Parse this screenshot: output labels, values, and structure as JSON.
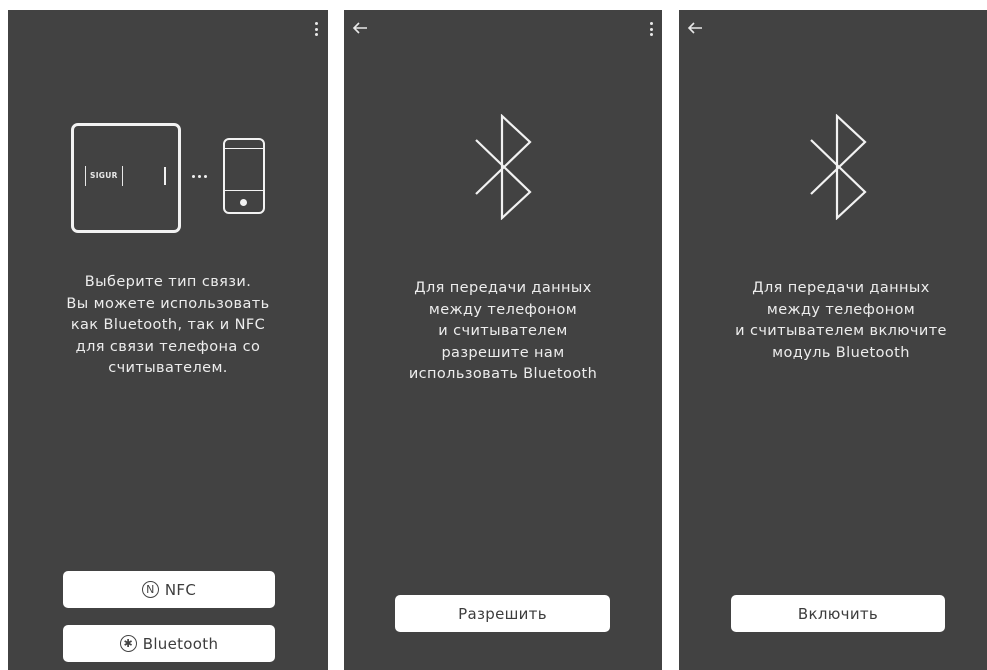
{
  "screens": [
    {
      "id": "connection-type",
      "illustration": {
        "reader_logo": "SIGUR"
      },
      "message": "Выберите тип связи.\nВы можете использовать\nкак Bluetooth, так и NFC\nдля связи телефона со\nсчитывателем.",
      "buttons": [
        {
          "label": "NFC",
          "icon": "nfc-icon",
          "icon_glyph": "N"
        },
        {
          "label": "Bluetooth",
          "icon": "bluetooth-icon",
          "icon_glyph": "✱"
        }
      ]
    },
    {
      "id": "bluetooth-permission",
      "message": "Для передачи данных\nмежду телефоном\nи считывателем\nразрешите нам\nиспользовать Bluetooth",
      "button_label": "Разрешить"
    },
    {
      "id": "bluetooth-enable",
      "message": "Для передачи данных\nмежду телефоном\nи считывателем включите\nмодуль Bluetooth",
      "button_label": "Включить"
    }
  ],
  "colors": {
    "screen_bg": "#424242",
    "text": "#ededed",
    "button_bg": "#ffffff",
    "button_text": "#3d3d3d"
  }
}
